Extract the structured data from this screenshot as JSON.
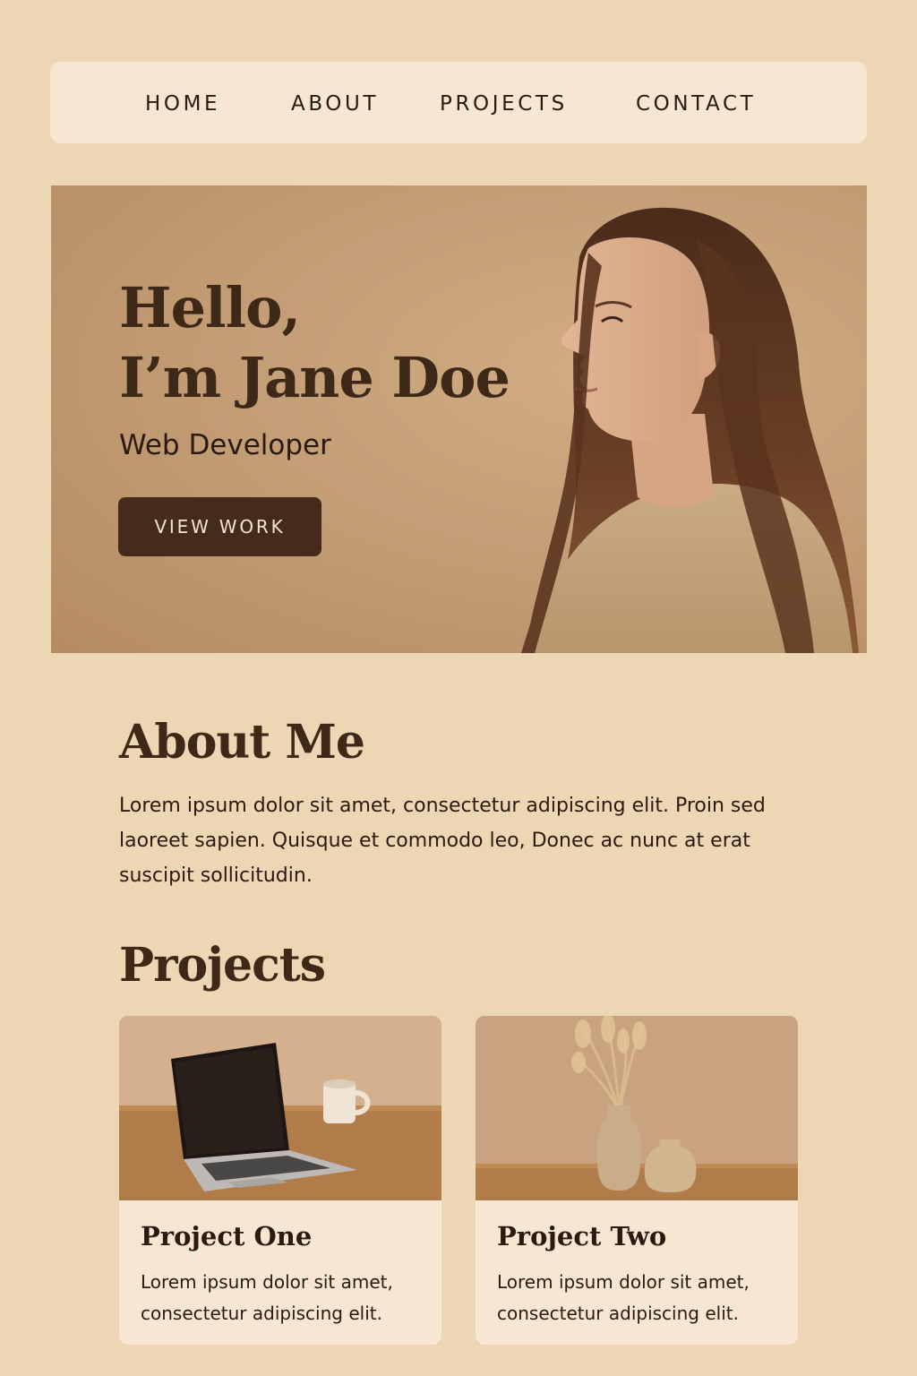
{
  "nav": {
    "items": [
      {
        "label": "HOME"
      },
      {
        "label": "ABOUT"
      },
      {
        "label": "PROJECTS"
      },
      {
        "label": "CONTACT"
      }
    ]
  },
  "hero": {
    "title_line1": "Hello,",
    "title_line2": "I’m Jane Doe",
    "subtitle": "Web Developer",
    "button_label": "VIEW WORK",
    "photo_icon": "portrait-photo-woman-profile"
  },
  "about": {
    "title": "About Me",
    "text": "Lorem ipsum dolor sit amet, consectetur adipiscing elit. Proin sed laoreet sapien. Quisque et commodo leo, Donec ac nunc at erat suscipit sollicitudin."
  },
  "projects": {
    "title": "Projects",
    "items": [
      {
        "title": "Project One",
        "description": "Lorem ipsum dolor sit amet, consectetur adipiscing elit.",
        "image_icon": "laptop-and-mug-photo"
      },
      {
        "title": "Project Two",
        "description": "Lorem ipsum dolor sit amet, consectetur adipiscing elit.",
        "image_icon": "vases-with-dried-grass-photo"
      }
    ]
  },
  "colors": {
    "page_background": "#ecd6b4",
    "nav_background": "#f7e7d2",
    "hero_background": "#c49e76",
    "heading_brown": "#3e2818",
    "button_background": "#442b1b",
    "button_text": "#f3e4d0",
    "card_background": "#f7e7d2"
  }
}
